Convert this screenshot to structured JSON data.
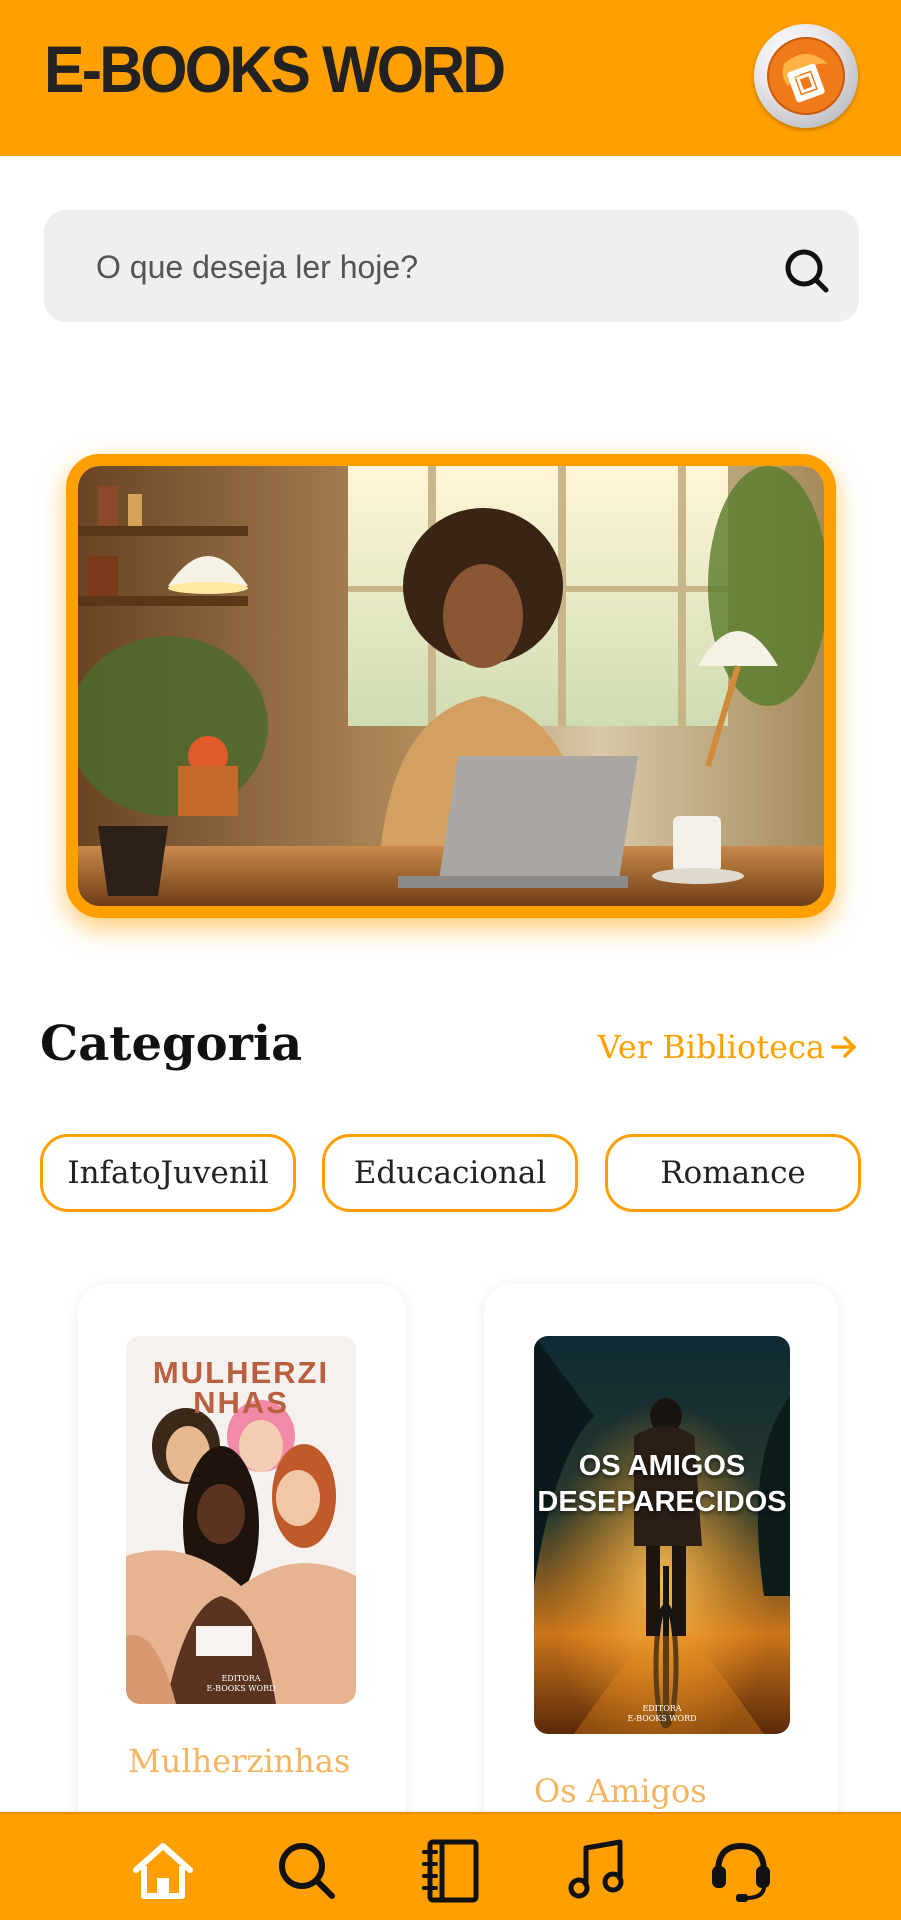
{
  "header": {
    "brand": "E-BOOKS WORD",
    "logo_icon": "globe-logo-icon",
    "accent_color": "#ff9f00"
  },
  "search": {
    "placeholder": "O que deseja ler hoje?",
    "icon": "search-icon"
  },
  "hero": {
    "image": "woman-reading-on-laptop-photo"
  },
  "category": {
    "title": "Categoria",
    "link_label": "Ver Biblioteca",
    "link_icon": "arrow-right-icon",
    "chips": [
      "InfatoJuvenil",
      "Educacional",
      "Romance"
    ]
  },
  "books": [
    {
      "title": "Mulherzinhas",
      "cover_title_line1": "MULHERZI",
      "cover_title_line2": "NHAS",
      "cover_editora": "EDITORA",
      "cover_publisher": "E-BOOKS WORD"
    },
    {
      "title": "Os Amigos",
      "cover_title_line1": "OS AMIGOS",
      "cover_title_line2": "DESEPARECIDOS",
      "cover_editora": "EDITORA",
      "cover_publisher": "E-BOOKS WORD"
    }
  ],
  "bottom_nav": {
    "items": [
      "home-icon",
      "search-icon",
      "library-book-icon",
      "music-note-icon",
      "headset-support-icon"
    ]
  }
}
